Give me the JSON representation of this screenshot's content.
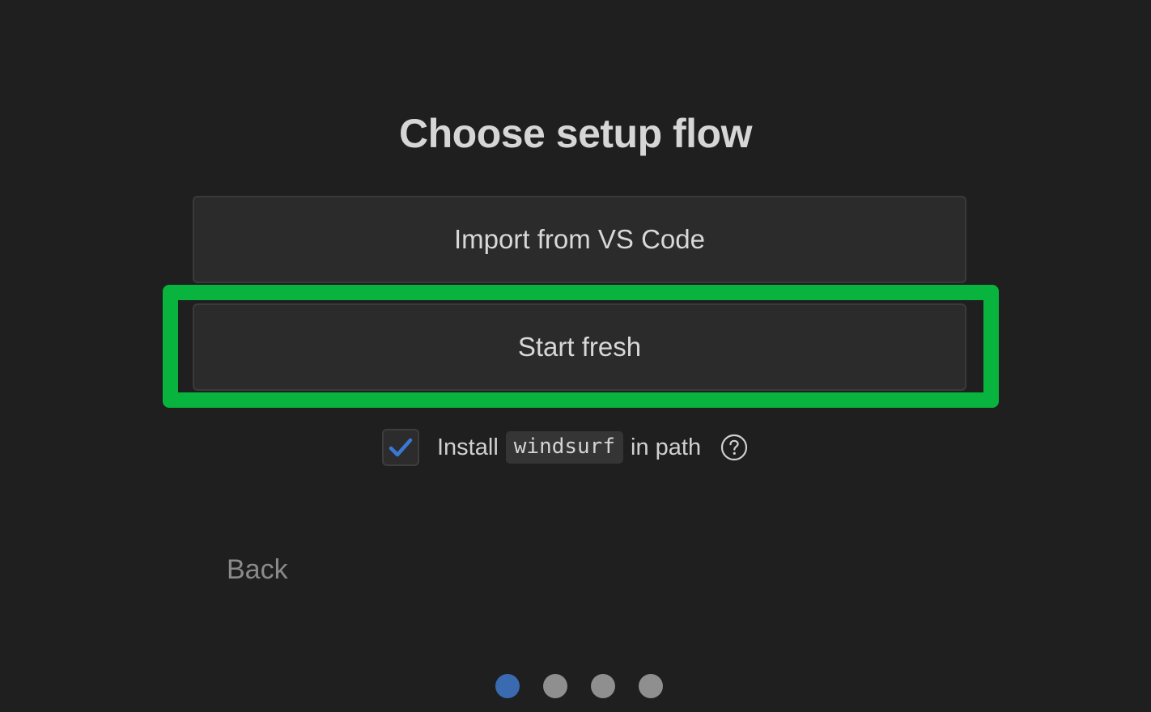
{
  "page": {
    "title": "Choose setup flow"
  },
  "options": {
    "import_label": "Import from VS Code",
    "fresh_label": "Start fresh"
  },
  "install_path": {
    "checked": true,
    "prefix": "Install",
    "command": "windsurf",
    "suffix": "in path"
  },
  "navigation": {
    "back_label": "Back"
  },
  "progress": {
    "total_steps": 4,
    "current_step": 1
  },
  "colors": {
    "background": "#1f1f1f",
    "highlight": "#08b43e",
    "check": "#3a78d4",
    "active_dot": "#3a6bb0",
    "inactive_dot": "#8f8f8f"
  },
  "icons": {
    "checkbox": "checkmark-icon",
    "help": "question-circle-icon"
  }
}
